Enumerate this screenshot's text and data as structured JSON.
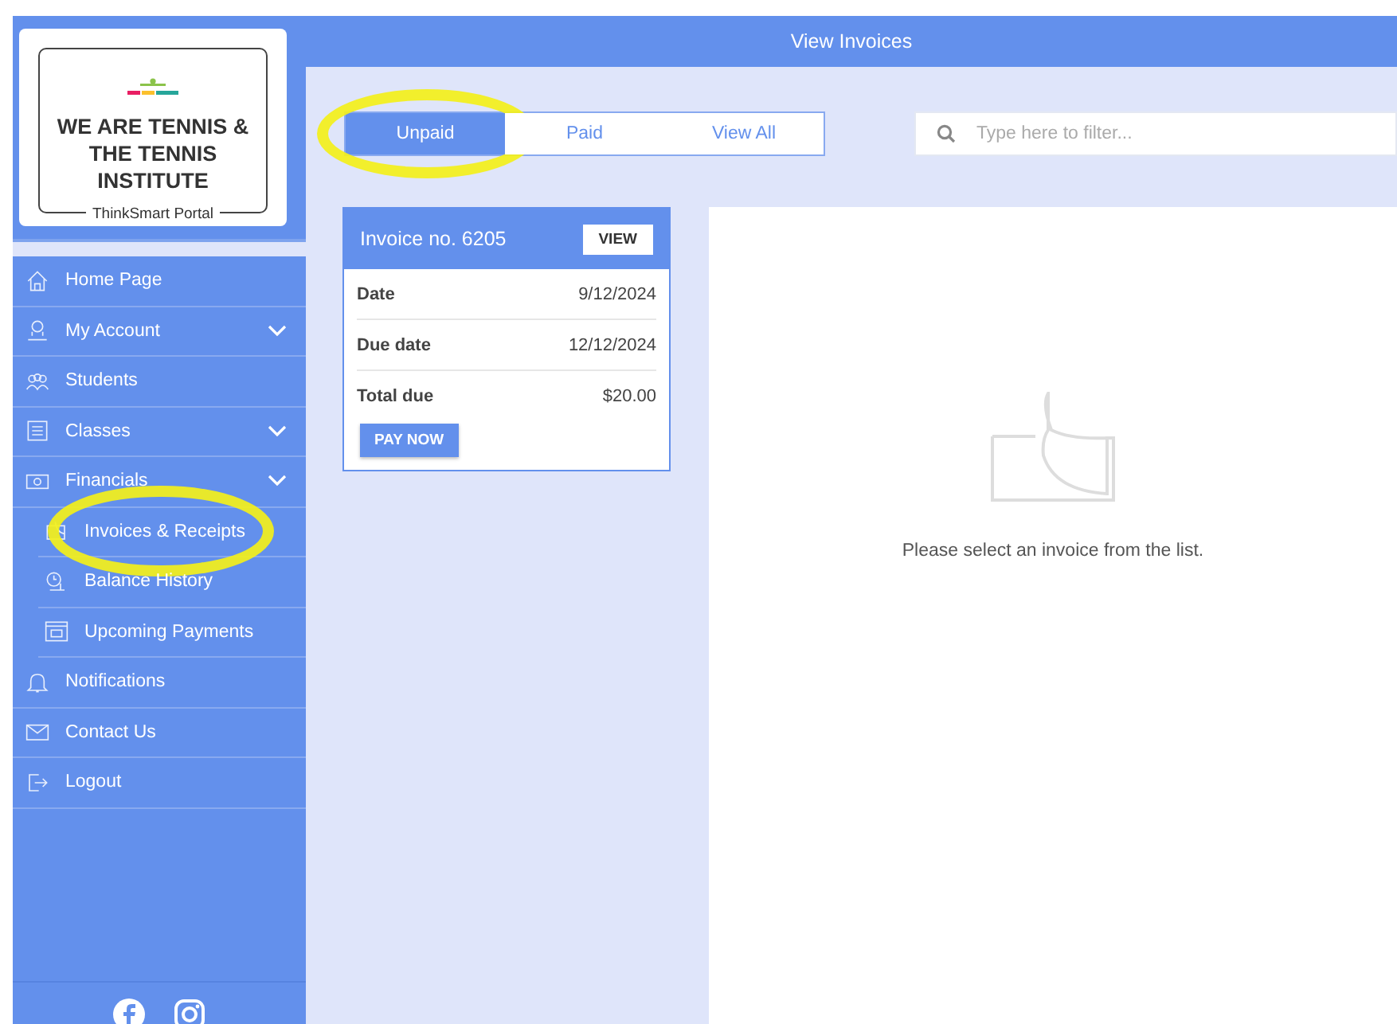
{
  "brand": {
    "title": "WE ARE TENNIS & THE TENNIS INSTITUTE",
    "subtitle": "ThinkSmart Portal"
  },
  "nav": [
    {
      "label": "Home Page",
      "kind": "link",
      "highlighted": false
    },
    {
      "label": "My Account",
      "kind": "group",
      "highlighted": false
    },
    {
      "label": "Students",
      "kind": "link",
      "highlighted": false
    },
    {
      "label": "Classes",
      "kind": "group",
      "highlighted": false
    },
    {
      "label": "Financials",
      "kind": "group",
      "highlighted": false,
      "children": [
        {
          "label": "Invoices & Receipts",
          "highlighted": true
        },
        {
          "label": "Balance History",
          "highlighted": false
        },
        {
          "label": "Upcoming Payments",
          "highlighted": false
        }
      ]
    },
    {
      "label": "Notifications",
      "kind": "link",
      "highlighted": false
    },
    {
      "label": "Contact Us",
      "kind": "link",
      "highlighted": false
    },
    {
      "label": "Logout",
      "kind": "link",
      "highlighted": false
    }
  ],
  "header": {
    "title": "View Invoices"
  },
  "tabs": [
    {
      "label": "Unpaid",
      "selected": true,
      "highlighted": true
    },
    {
      "label": "Paid",
      "selected": false,
      "highlighted": false
    },
    {
      "label": "View All",
      "selected": false,
      "highlighted": false
    }
  ],
  "search": {
    "placeholder": "Type here to filter..."
  },
  "invoices": [
    {
      "title": "Invoice no. 6205",
      "view_button": "VIEW",
      "pay_button": "PAY NOW",
      "fields": [
        {
          "label": "Date",
          "value": "9/12/2024"
        },
        {
          "label": "Due date",
          "value": "12/12/2024"
        },
        {
          "label": "Total due",
          "value": "$20.00"
        }
      ]
    }
  ],
  "detail": {
    "message": "Please select an invoice from the list."
  }
}
